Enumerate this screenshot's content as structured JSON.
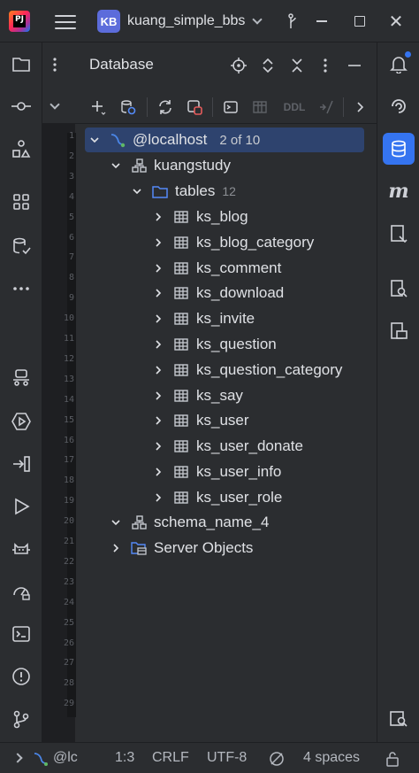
{
  "titlebar": {
    "project_badge": "KB",
    "project_name": "kuang_simple_bbs"
  },
  "database_panel": {
    "title": "Database",
    "toolbar": {
      "ddl_label": "DDL"
    },
    "tree": {
      "datasource": {
        "label": "@localhost",
        "count": "2 of 10"
      },
      "schemas": [
        {
          "label": "kuangstudy",
          "folder": {
            "label": "tables",
            "count": "12"
          },
          "tables": [
            "ks_blog",
            "ks_blog_category",
            "ks_comment",
            "ks_download",
            "ks_invite",
            "ks_question",
            "ks_question_category",
            "ks_say",
            "ks_user",
            "ks_user_donate",
            "ks_user_info",
            "ks_user_role"
          ]
        },
        {
          "label": "schema_name_4"
        }
      ],
      "server_objects": {
        "label": "Server Objects"
      }
    }
  },
  "gutter": {
    "line_numbers": [
      "1",
      "2",
      "3",
      "4",
      "5",
      "6",
      "7",
      "8",
      "9",
      "10",
      "11",
      "12",
      "13",
      "14",
      "15",
      "16",
      "17",
      "18",
      "19",
      "20",
      "21",
      "22",
      "23",
      "24",
      "25",
      "26",
      "27",
      "28",
      "29"
    ]
  },
  "statusbar": {
    "datasource": "@lc",
    "position": "1:3",
    "line_separator": "CRLF",
    "encoding": "UTF-8",
    "indent": "4 spaces"
  },
  "colors": {
    "accent": "#3574f0",
    "selection": "#2e436e",
    "panel_bg": "#2b2d30",
    "editor_bg": "#1e1f22",
    "table_icon": "#c5c8cf",
    "folder_icon": "#548af7"
  }
}
